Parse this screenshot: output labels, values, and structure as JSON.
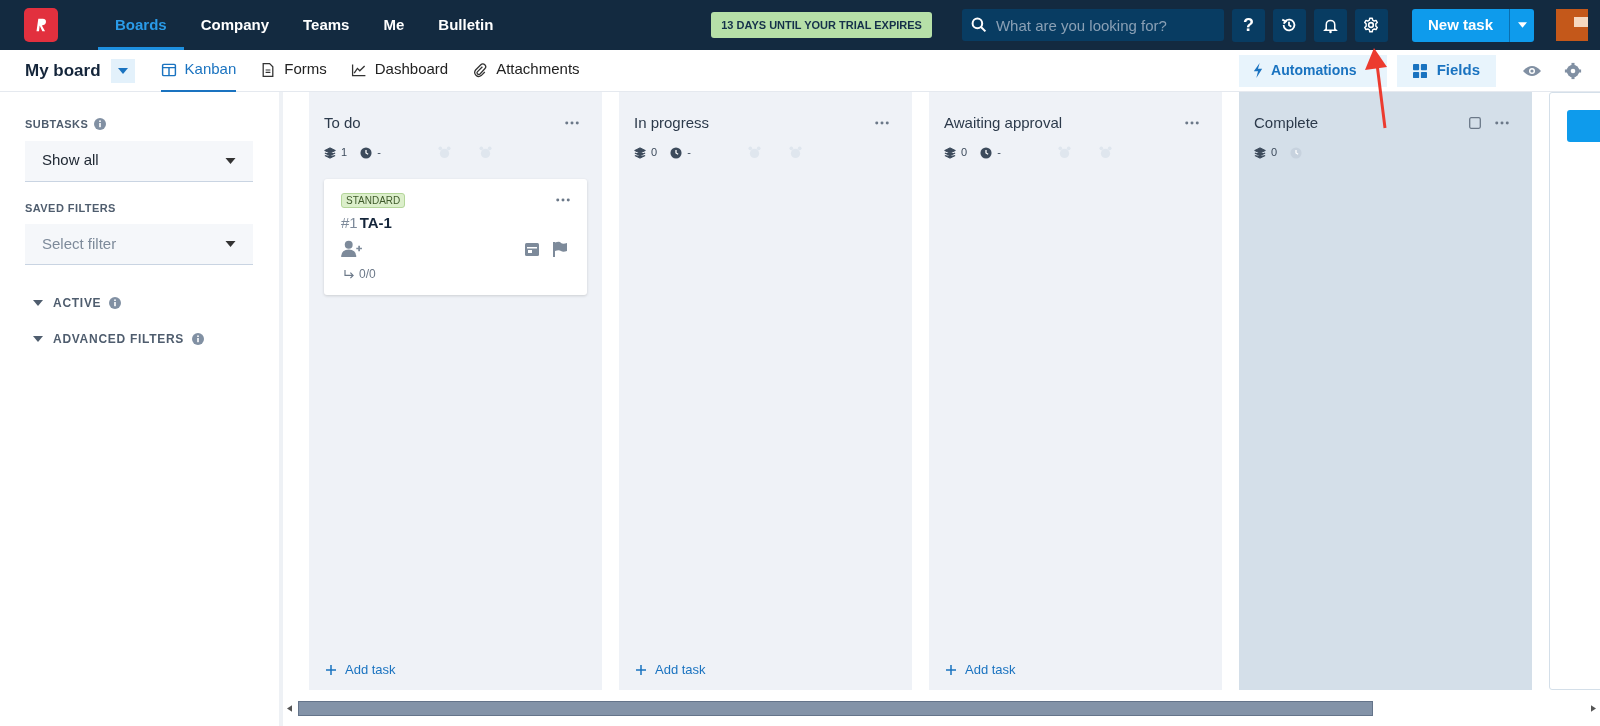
{
  "nav": {
    "tabs": [
      {
        "label": "Boards",
        "selected": true
      },
      {
        "label": "Company",
        "selected": false
      },
      {
        "label": "Teams",
        "selected": false
      },
      {
        "label": "Me",
        "selected": false
      },
      {
        "label": "Bulletin",
        "selected": false
      }
    ],
    "trial_badge": "13 DAYS UNTIL YOUR TRIAL EXPIRES",
    "search": {
      "placeholder": "What are you looking for?"
    },
    "help_label": "?",
    "new_task": "New task"
  },
  "board": {
    "title": "My board",
    "views": [
      {
        "label": "Kanban",
        "selected": true
      },
      {
        "label": "Forms",
        "selected": false
      },
      {
        "label": "Dashboard",
        "selected": false
      },
      {
        "label": "Attachments",
        "selected": false
      }
    ],
    "automations": "Automations",
    "fields": "Fields"
  },
  "sidebar": {
    "subtasks": {
      "label": "SUBTASKS",
      "value": "Show all"
    },
    "saved_filters": {
      "label": "SAVED FILTERS",
      "placeholder": "Select filter"
    },
    "sections": [
      {
        "label": "ACTIVE",
        "expanded": true
      },
      {
        "label": "ADVANCED FILTERS",
        "expanded": true
      }
    ]
  },
  "columns": [
    {
      "kind": "open",
      "title": "To do",
      "count": "1",
      "time": "-",
      "add_label": "Add task",
      "cards": [
        {
          "tag": "STANDARD",
          "number": "#1",
          "title": "TA-1",
          "subtasks": "0/0"
        }
      ]
    },
    {
      "kind": "open",
      "title": "In progress",
      "count": "0",
      "time": "-",
      "add_label": "Add task"
    },
    {
      "kind": "open",
      "title": "Awaiting approval",
      "count": "0",
      "time": "-",
      "add_label": "Add task"
    },
    {
      "kind": "done",
      "title": "Complete",
      "count": "0"
    }
  ]
}
